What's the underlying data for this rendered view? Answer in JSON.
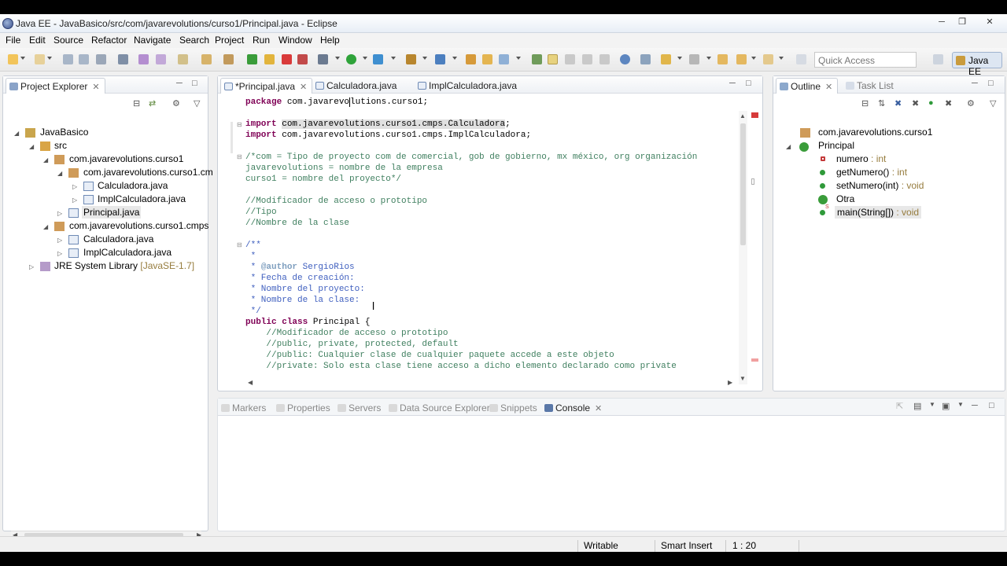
{
  "window": {
    "title": "Java EE - JavaBasico/src/com/javarevolutions/curso1/Principal.java - Eclipse"
  },
  "menu": [
    "File",
    "Edit",
    "Source",
    "Refactor",
    "Navigate",
    "Search",
    "Project",
    "Run",
    "Window",
    "Help"
  ],
  "toolbar": {
    "quick_access_placeholder": "Quick Access",
    "perspective": "Java EE"
  },
  "project_explorer": {
    "title": "Project Explorer",
    "tree": [
      {
        "label": "JavaBasico"
      },
      {
        "label": "src"
      },
      {
        "label": "com.javarevolutions.curso1"
      },
      {
        "label": "com.javarevolutions.curso1.cm"
      },
      {
        "label": "Calculadora.java"
      },
      {
        "label": "ImplCalculadora.java"
      },
      {
        "label": "Principal.java"
      },
      {
        "label": "com.javarevolutions.curso1.cmps"
      },
      {
        "label": "Calculadora.java"
      },
      {
        "label": "ImplCalculadora.java"
      },
      {
        "label": "JRE System Library",
        "suffix": "[JavaSE-1.7]"
      }
    ]
  },
  "editor": {
    "tabs": [
      {
        "label": "*Principal.java"
      },
      {
        "label": "Calculadora.java"
      },
      {
        "label": "ImplCalculadora.java"
      }
    ],
    "lines": [
      "package com.javarevolutions.curso1;",
      "",
      "import com.javarevolutions.curso1.cmps.Calculadora;",
      "import com.javarevolutions.curso1.cmps.ImplCalculadora;",
      "",
      "/*com = Tipo de proyecto com de comercial, gob de gobierno, mx méxico, org organización",
      "javarevolutions = nombre de la empresa",
      "curso1 = nombre del proyecto*/",
      "",
      "//Modificador de acceso o prototipo",
      "//Tipo",
      "//Nombre de la clase",
      "",
      "/**",
      " *",
      " * @author SergioRios",
      " * Fecha de creación:",
      " * Nombre del proyecto:",
      " * Nombre de la clase:",
      " */",
      "public class Principal {",
      "    //Modificador de acceso o prototipo",
      "    //public, private, protected, default",
      "    //public: Cualquier clase de cualquier paquete accede a este objeto",
      "    //private: Solo esta clase tiene acceso a dicho elemento declarado como private"
    ]
  },
  "outline": {
    "title": "Outline",
    "task_list": "Task List",
    "items": [
      {
        "label": "com.javarevolutions.curso1",
        "type": ""
      },
      {
        "label": "Principal",
        "type": ""
      },
      {
        "label": "numero",
        "type": " : int"
      },
      {
        "label": "getNumero()",
        "type": " : int"
      },
      {
        "label": "setNumero(int)",
        "type": " : void"
      },
      {
        "label": "Otra",
        "type": ""
      },
      {
        "label": "main(String[])",
        "type": " : void"
      }
    ]
  },
  "bottom_panel": {
    "tabs": [
      "Markers",
      "Properties",
      "Servers",
      "Data Source Explorer",
      "Snippets",
      "Console"
    ]
  },
  "status_bar": {
    "writable": "Writable",
    "insert_mode": "Smart Insert",
    "position": "1 : 20"
  }
}
